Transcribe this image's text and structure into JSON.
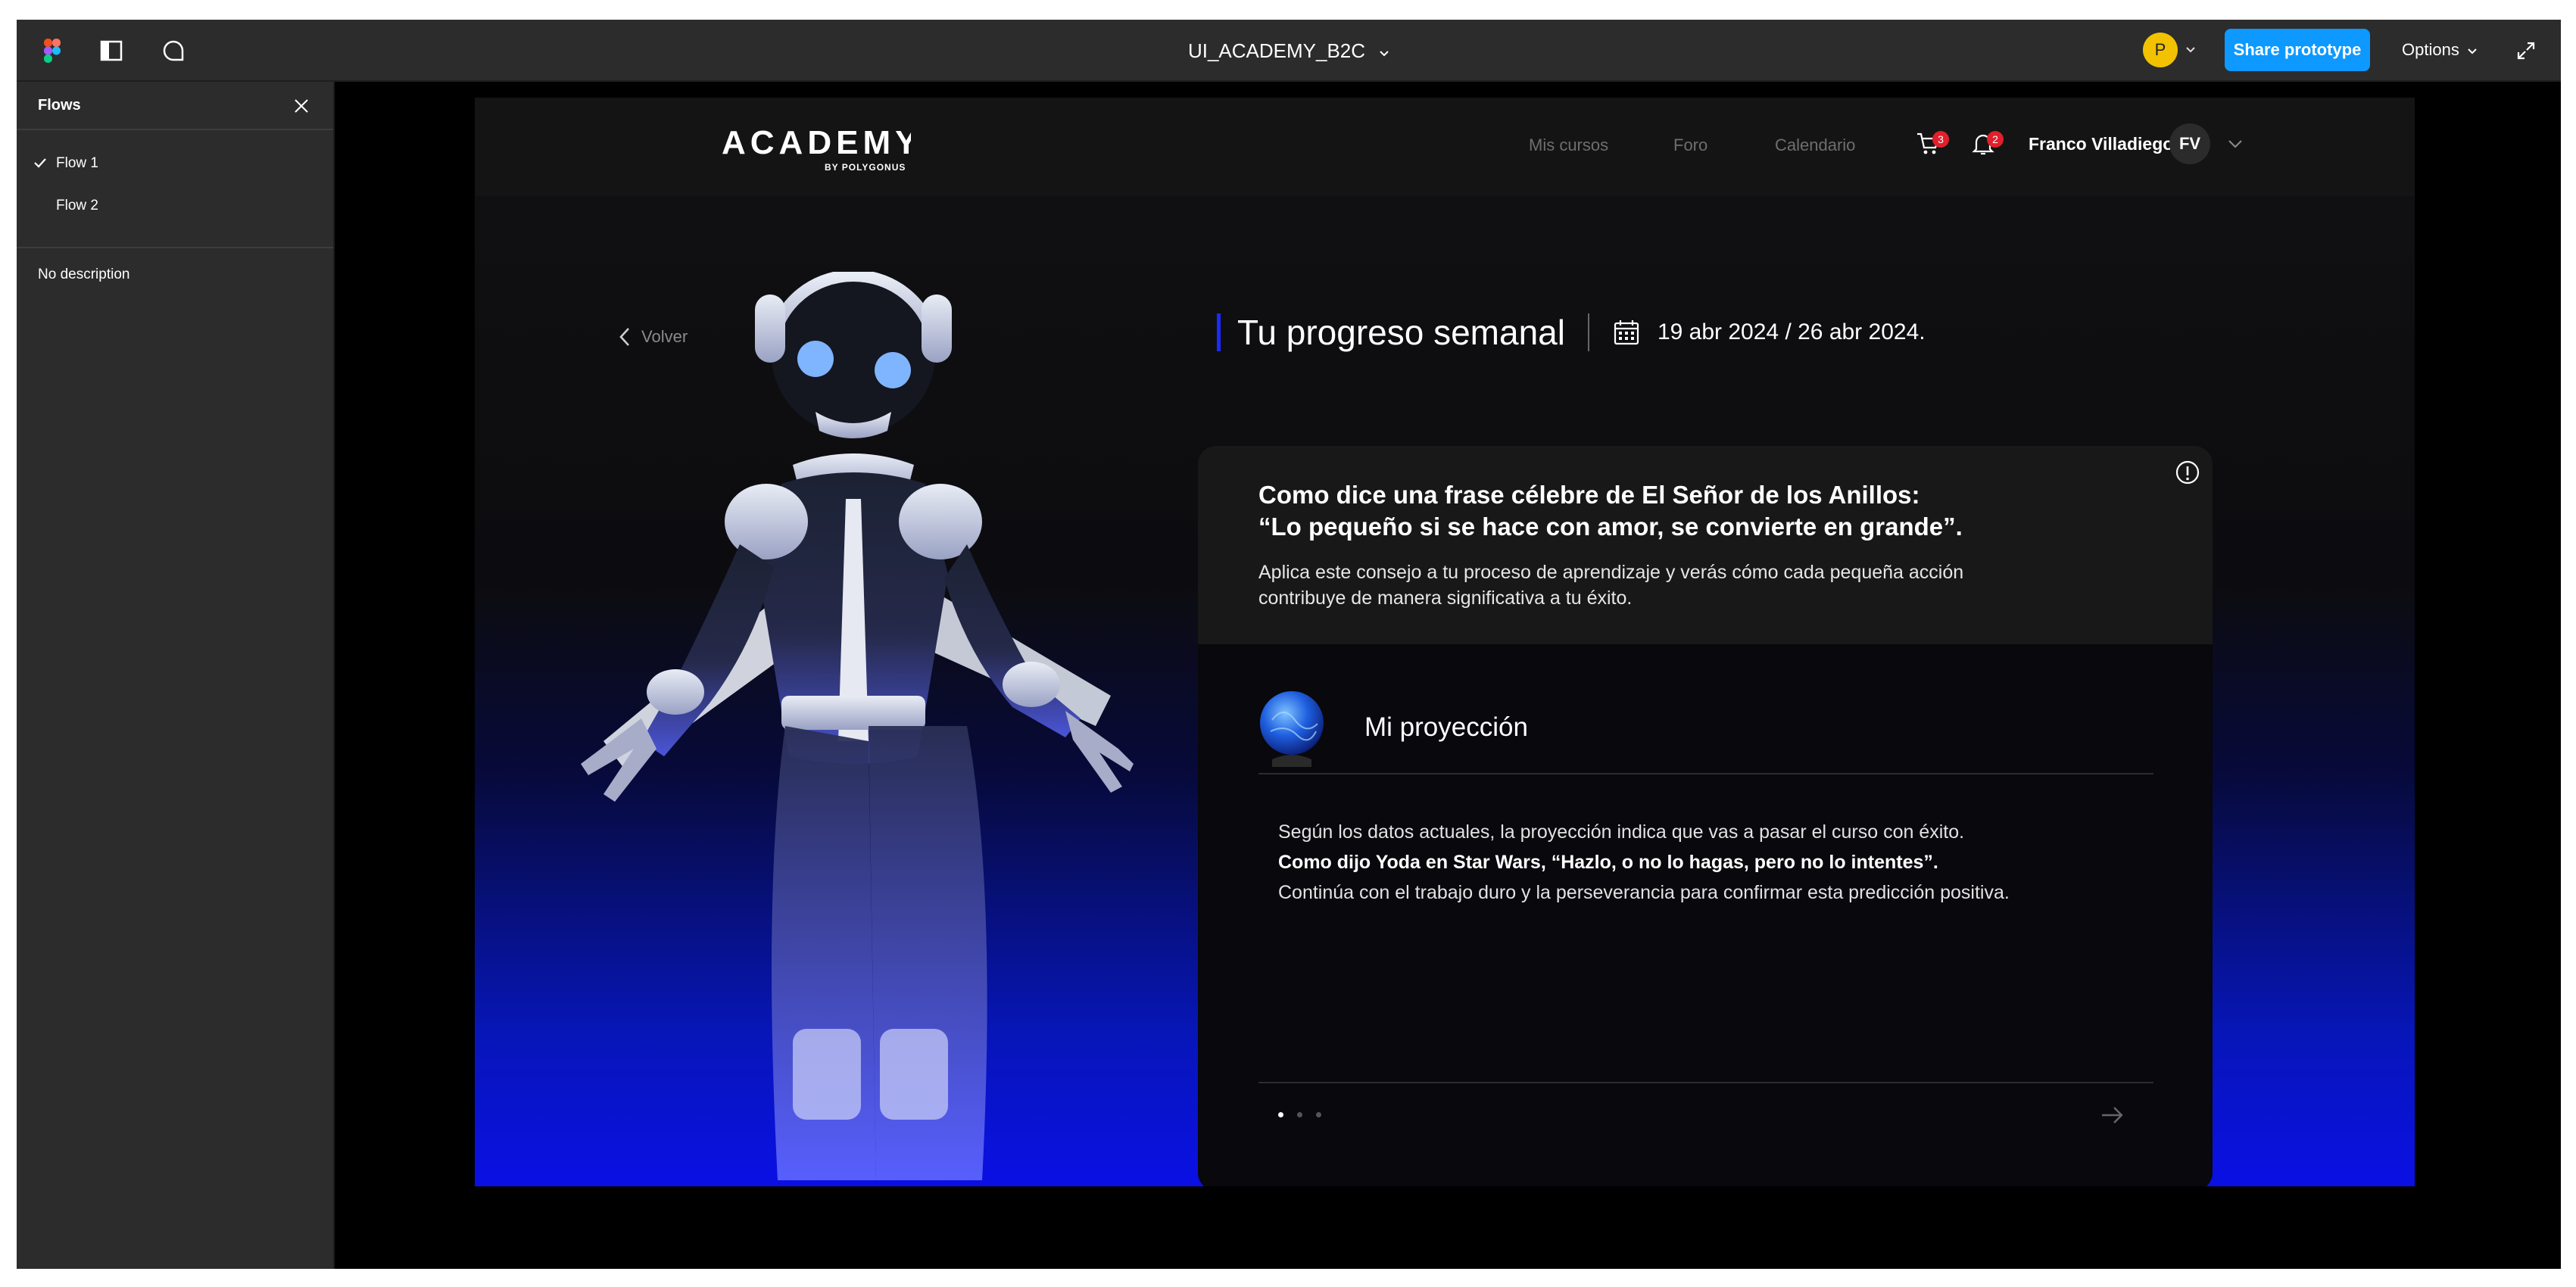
{
  "figma": {
    "file_title": "UI_ACADEMY_B2C",
    "user_initial": "P",
    "share_label": "Share prototype",
    "options_label": "Options",
    "accent": "#0d99ff"
  },
  "flows_panel": {
    "title": "Flows",
    "items": [
      {
        "label": "Flow 1",
        "selected": true
      },
      {
        "label": "Flow 2",
        "selected": false
      }
    ],
    "description": "No description"
  },
  "academy": {
    "logo_text": "ACADEMY",
    "logo_sub": "BY POLYGONUS",
    "nav": [
      "Mis cursos",
      "Foro",
      "Calendario"
    ],
    "cart_count": "3",
    "notifications_count": "2",
    "user_name": "Franco Villadiego",
    "user_initials": "FV",
    "back_label": "Volver",
    "page_title": "Tu progreso semanal",
    "date_range": "19 abr 2024 / 26 abr 2024.",
    "quote_line1": "Como dice una frase célebre de El Señor de los Anillos:",
    "quote_line2": "“Lo pequeño si se hace con amor, se convierte en grande”.",
    "quote_sub": "Aplica este consejo a tu proceso de aprendizaje y verás cómo cada pequeña acción contribuye de manera significativa a tu éxito.",
    "projection_title": "Mi proyección",
    "projection_line1": "Según los datos actuales, la proyección indica que vas a pasar el curso con éxito.",
    "projection_line2": "Como dijo Yoda en Star Wars, “Hazlo, o no lo hagas, pero no lo intentes”.",
    "projection_line3": "Continúa con el trabajo duro y la perseverancia para confirmar esta predicción positiva.",
    "badge_color": "#e0202c",
    "brand_blue": "#1a2bff"
  }
}
